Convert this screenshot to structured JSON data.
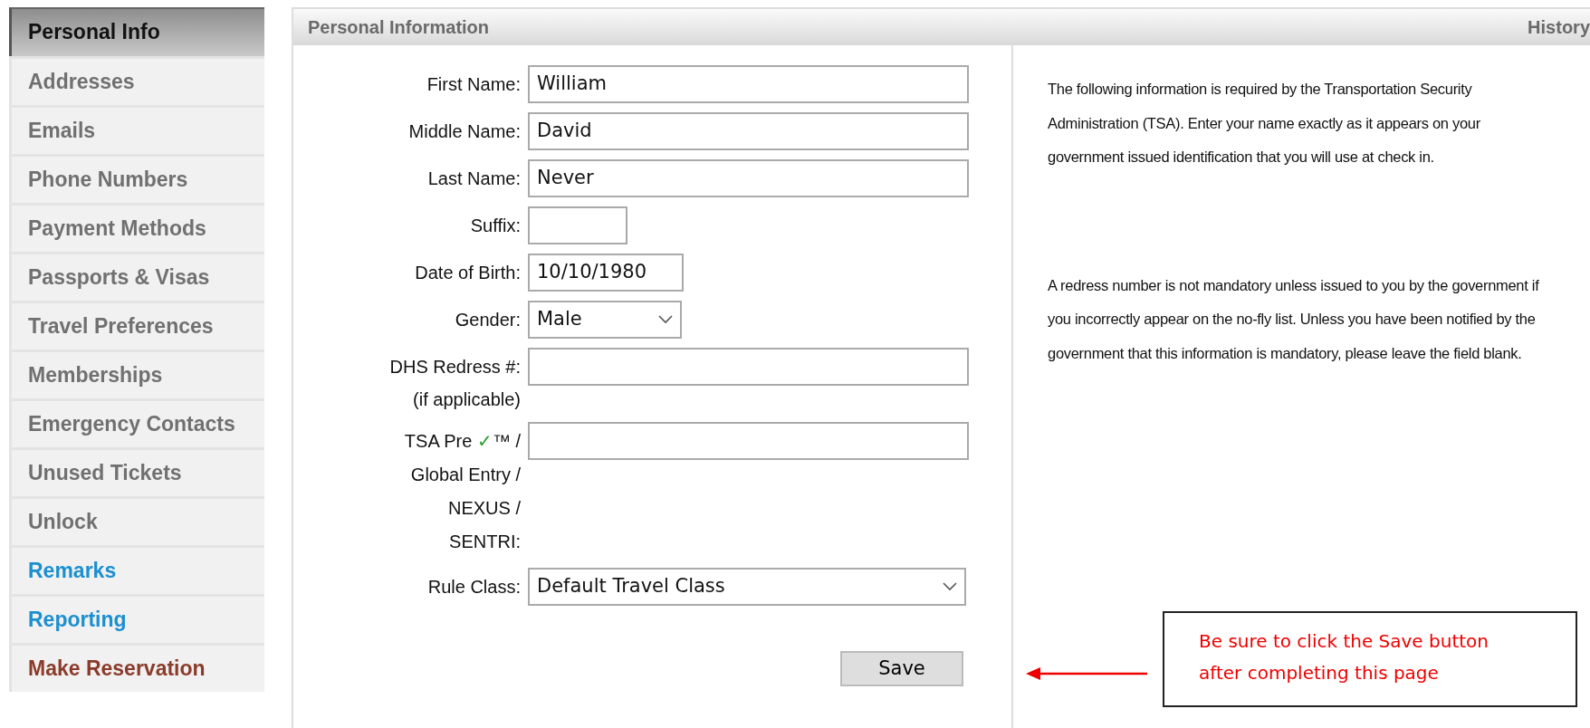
{
  "sidebar": {
    "items": [
      {
        "label": "Personal Info",
        "kind": "page",
        "selected": true
      },
      {
        "label": "Addresses",
        "kind": "page",
        "selected": false
      },
      {
        "label": "Emails",
        "kind": "page",
        "selected": false
      },
      {
        "label": "Phone Numbers",
        "kind": "page",
        "selected": false
      },
      {
        "label": "Payment Methods",
        "kind": "page",
        "selected": false
      },
      {
        "label": "Passports & Visas",
        "kind": "page",
        "selected": false
      },
      {
        "label": "Travel Preferences",
        "kind": "page",
        "selected": false
      },
      {
        "label": "Memberships",
        "kind": "page",
        "selected": false
      },
      {
        "label": "Emergency Contacts",
        "kind": "page",
        "selected": false
      },
      {
        "label": "Unused Tickets",
        "kind": "page",
        "selected": false
      },
      {
        "label": "Unlock",
        "kind": "page",
        "selected": false
      },
      {
        "label": "Remarks",
        "kind": "link",
        "selected": false
      },
      {
        "label": "Reporting",
        "kind": "link",
        "selected": false
      },
      {
        "label": "Make Reservation",
        "kind": "action",
        "selected": false
      }
    ]
  },
  "panel": {
    "title": "Personal Information",
    "history_link": "History",
    "form": [
      {
        "label_lines": [
          "First Name:"
        ],
        "kind": "text",
        "value": "William"
      },
      {
        "label_lines": [
          "Middle Name:"
        ],
        "kind": "text",
        "value": "David"
      },
      {
        "label_lines": [
          "Last Name:"
        ],
        "kind": "text",
        "value": "Never"
      },
      {
        "label_lines": [
          "Suffix:"
        ],
        "kind": "short"
      },
      {
        "label_lines": [
          "Date of Birth:"
        ],
        "kind": "date",
        "value": "10/10/1980"
      },
      {
        "label_lines": [
          "Gender:"
        ],
        "kind": "select",
        "value": "Male"
      },
      {
        "label_lines": [
          "DHS Redress #:"
        ],
        "note": "(if applicable)",
        "kind": "text"
      },
      {
        "label_lines": [
          [
            {
              "text": "TSA Pre "
            },
            {
              "text": "✓",
              "color": "#2aa02a"
            },
            {
              "text": "™ /"
            }
          ],
          "Global Entry /",
          "NEXUS /",
          "SENTRI:"
        ],
        "kind": "text"
      },
      {
        "label_lines": [
          "Rule Class:"
        ],
        "kind": "wide-select",
        "value": "Default Travel Class"
      }
    ],
    "save_button": "Save",
    "help": [
      "The following information is required by the Transportation Security Administration (TSA). Enter your name exactly as it appears on your government issued identification that you will use at check in.",
      "A redress number is not mandatory unless issued to you by the government if you incorrectly appear on the no-fly list. Unless you have been notified by the government that this information is mandatory, please leave the field blank."
    ]
  },
  "callout": {
    "text": "Be sure to click the Save button after completing this page"
  }
}
